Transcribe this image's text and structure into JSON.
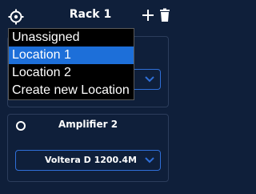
{
  "colors": {
    "background": "#0f1f3a",
    "accent": "#2f6fd8",
    "highlight": "#1d6fd9",
    "dropdown_bg": "#000000",
    "text": "#ffffff"
  },
  "header": {
    "title": "Rack 1",
    "location_icon": "location-target-icon",
    "add_icon": "plus-icon",
    "delete_icon": "trash-icon"
  },
  "dropdown": {
    "options": [
      "Unassigned",
      "Location 1",
      "Location 2",
      "Create new Location"
    ],
    "selected": "Location 1"
  },
  "cards": [
    {
      "title": "",
      "select_value": "",
      "selected": false
    },
    {
      "title": "Amplifier 2",
      "select_value": "Voltera D 1200.4M",
      "selected": false
    }
  ]
}
